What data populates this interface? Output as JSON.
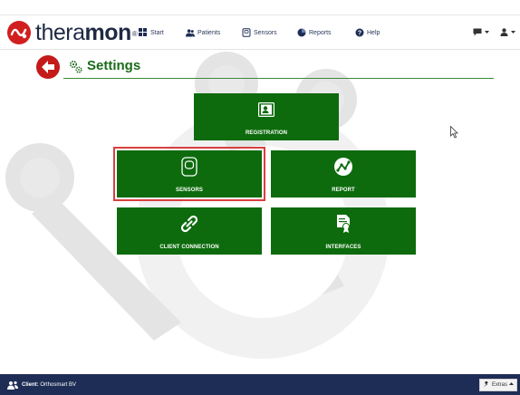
{
  "app": {
    "logo_prefix": "thera",
    "logo_emphasis": "mon",
    "logo_reg": "®"
  },
  "nav": {
    "items": [
      {
        "label": "Start",
        "icon": "grid-icon"
      },
      {
        "label": "Patients",
        "icon": "users-icon"
      },
      {
        "label": "Sensors",
        "icon": "sensor-icon"
      },
      {
        "label": "Reports",
        "icon": "pie-chart-icon"
      },
      {
        "label": "Help",
        "icon": "help-circle-icon"
      }
    ],
    "messages_icon": "message-icon",
    "user_icon": "user-icon"
  },
  "page": {
    "title": "Settings"
  },
  "tiles": [
    {
      "label": "REGISTRATION",
      "icon": "id-card-icon",
      "selected": false
    },
    {
      "label": "SENSORS",
      "icon": "sensor-device-icon",
      "selected": true
    },
    {
      "label": "REPORT",
      "icon": "report-chart-icon",
      "selected": false
    },
    {
      "label": "CLIENT CONNECTION",
      "icon": "link-icon",
      "selected": false
    },
    {
      "label": "INTERFACES",
      "icon": "certificate-icon",
      "selected": false
    }
  ],
  "footer": {
    "client_label": "Client:",
    "client_name": "Orthosmart BV",
    "extras_label": "Extras"
  },
  "colors": {
    "tile_green": "#0d6b0d",
    "title_green": "#1b6b1b",
    "footer_navy": "#1e2d55",
    "accent_red": "#c41a1a",
    "selected_outline": "#d84040"
  }
}
